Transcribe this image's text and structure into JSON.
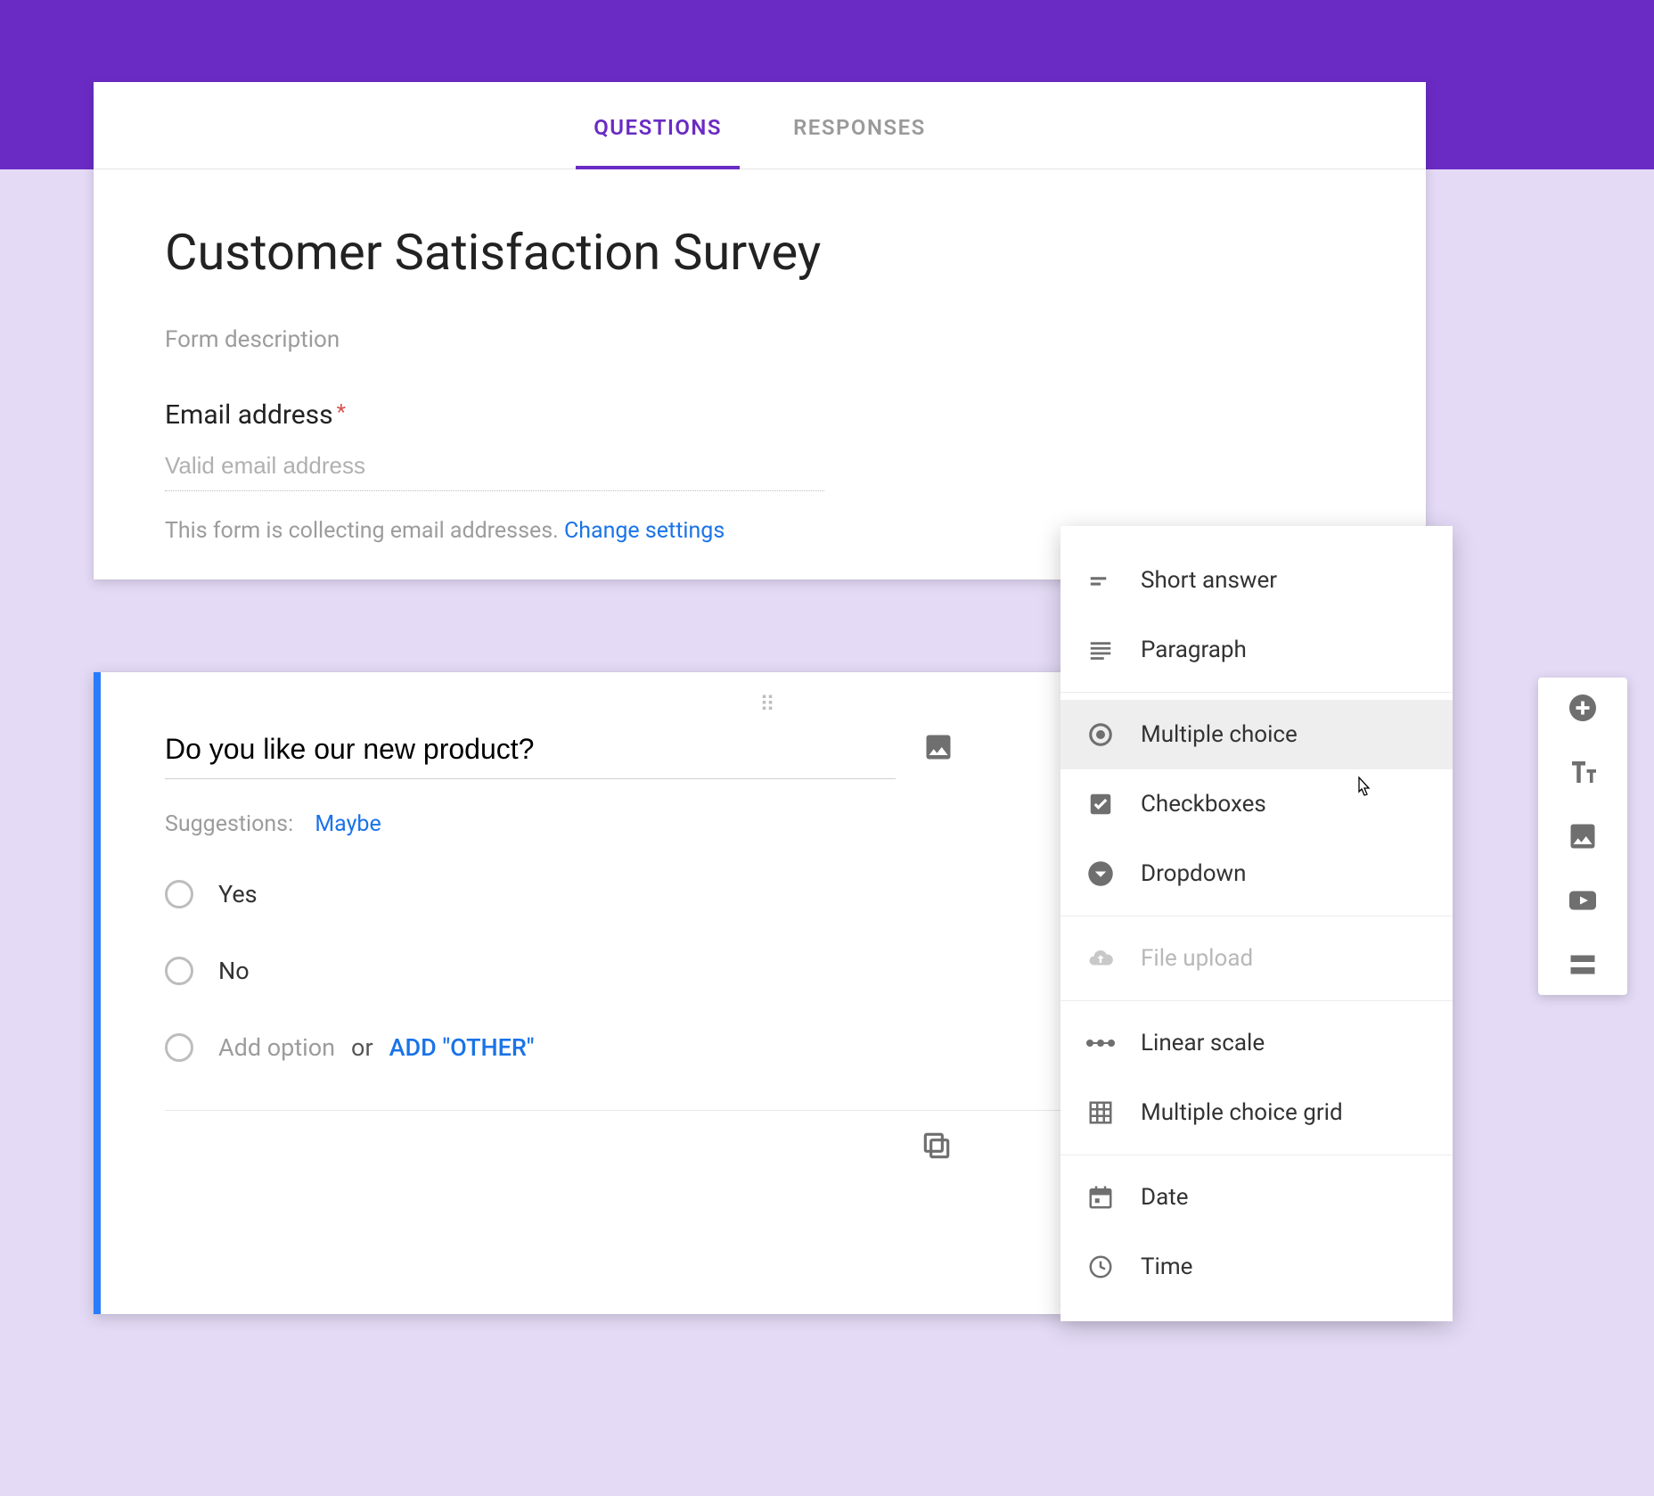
{
  "tabs": {
    "questions": "QUESTIONS",
    "responses": "RESPONSES"
  },
  "form": {
    "title": "Customer Satisfaction Survey",
    "description_placeholder": "Form description",
    "email_label": "Email address",
    "email_placeholder": "Valid email address",
    "collecting_text": "This form is collecting email addresses.  ",
    "change_settings": "Change settings"
  },
  "question": {
    "title": "Do you like our new product?",
    "suggestions_label": "Suggestions:",
    "suggestion_value": "Maybe",
    "options": [
      "Yes",
      "No"
    ],
    "add_option": "Add option",
    "or": "or",
    "add_other": "ADD \"OTHER\""
  },
  "menu": {
    "short_answer": "Short answer",
    "paragraph": "Paragraph",
    "multiple_choice": "Multiple choice",
    "checkboxes": "Checkboxes",
    "dropdown": "Dropdown",
    "file_upload": "File upload",
    "linear_scale": "Linear scale",
    "mc_grid": "Multiple choice grid",
    "date": "Date",
    "time": "Time"
  }
}
